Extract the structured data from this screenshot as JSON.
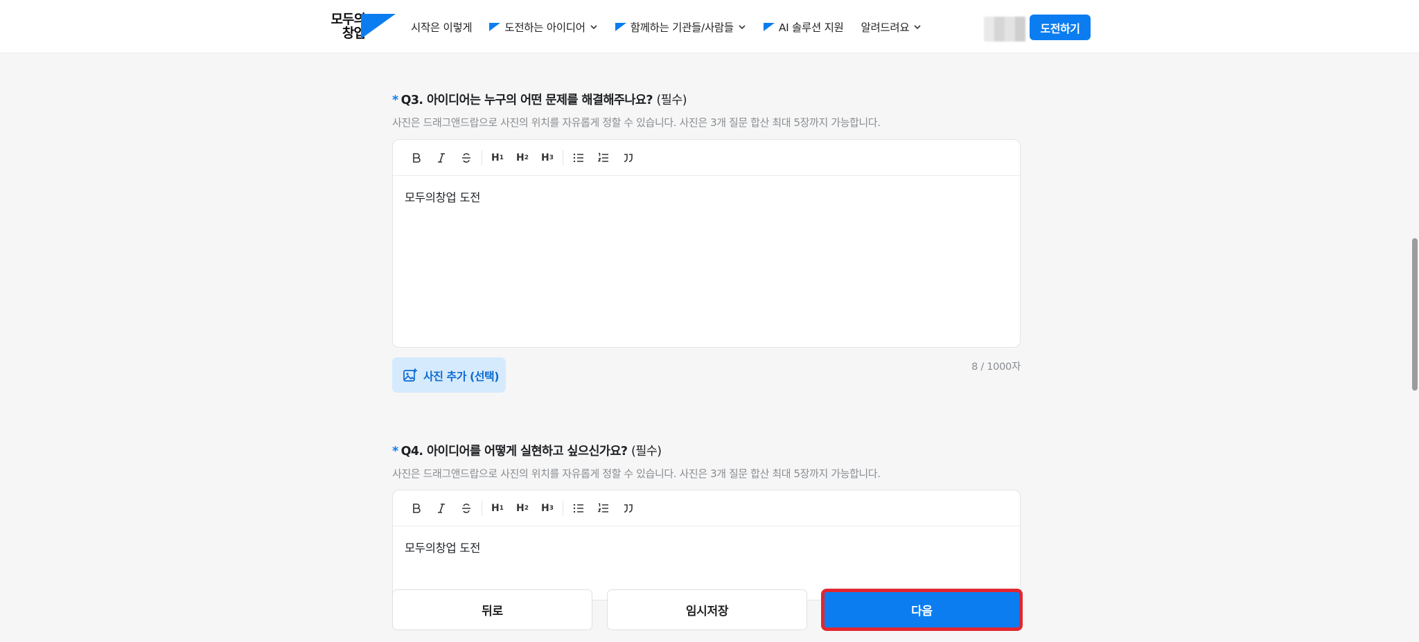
{
  "header": {
    "logo_text": "모두의 창업",
    "nav": [
      {
        "label": "시작은 이렇게",
        "flag": false,
        "dropdown": false
      },
      {
        "label": "도전하는 아이디어",
        "flag": true,
        "dropdown": true
      },
      {
        "label": "함께하는 기관들/사람들",
        "flag": true,
        "dropdown": true
      },
      {
        "label": "AI 솔루션 지원",
        "flag": true,
        "dropdown": false
      },
      {
        "label": "알려드려요",
        "flag": false,
        "dropdown": true
      }
    ],
    "cta_label": "도전하기"
  },
  "q3": {
    "star": "*",
    "title": "Q3. 아이디어는 누구의 어떤 문제를 해결해주나요?",
    "required": "(필수)",
    "hint": "사진은 드래그앤드랍으로 사진의 위치를 자유롭게 정할 수 있습니다. 사진은 3개 질문 합산 최대 5장까지 가능합니다.",
    "content": "모두의창업 도전",
    "photo_button": "사진 추가 (선택)",
    "counter": "8 / 1000자"
  },
  "q4": {
    "star": "*",
    "title": "Q4. 아이디어를 어떻게 실현하고 싶으신가요?",
    "required": "(필수)",
    "hint": "사진은 드래그앤드랍으로 사진의 위치를 자유롭게 정할 수 있습니다. 사진은 3개 질문 합산 최대 5장까지 가능합니다.",
    "content": "모두의창업 도전"
  },
  "toolbar": {
    "h1": "H",
    "h2": "H",
    "h3": "H",
    "n1": "1",
    "n2": "2",
    "n3": "3"
  },
  "buttons": {
    "back": "뒤로",
    "save": "임시저장",
    "next": "다음"
  },
  "colors": {
    "accent": "#0c7df0",
    "highlight_border": "#e3262f",
    "photo_button_bg": "#d6eafd"
  }
}
